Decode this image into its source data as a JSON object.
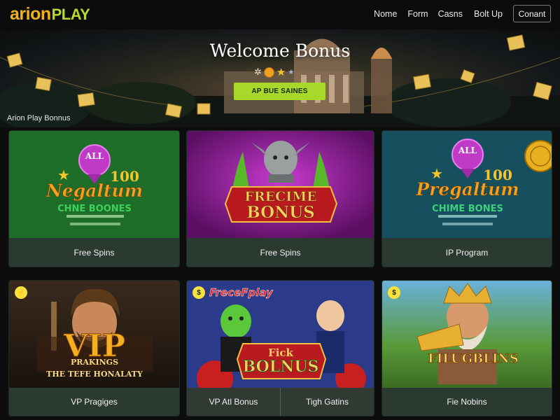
{
  "nav": {
    "logo_brand": "arion",
    "logo_play": "PLAY",
    "links": [
      "Nome",
      "Form",
      "Casns",
      "Bolt Up"
    ],
    "contact_label": "Conant"
  },
  "hero": {
    "title": "Welcome Bonus",
    "cta_label": "AP BUE SAINES",
    "section_label": "Arion Play Bonnus"
  },
  "cards": [
    {
      "caption": "Free Spins",
      "art_badge": "ALL",
      "art_number": "100",
      "art_title": "Negaltum",
      "art_subtitle": "CHNE BOONES"
    },
    {
      "caption": "Free Spins",
      "art_title_1": "FRECIME",
      "art_title_2": "BONUS"
    },
    {
      "caption": "IP Program",
      "art_badge": "ALL",
      "art_number": "100",
      "art_title": "Pregaltum",
      "art_subtitle": "CHIME BONES"
    },
    {
      "caption": "VP Pragiges",
      "art_title": "VIP",
      "art_subtitle_1": "PRAKINGS",
      "art_subtitle_2": "THE TEFE HONALATY"
    },
    {
      "caption_left": "VP Atl Bonus",
      "caption_right": "Tigh Gatins",
      "art_brand": "FreceFplay",
      "art_title_1": "Fick",
      "art_title_2": "BOLNUS"
    },
    {
      "caption": "Fie Nobins",
      "art_title": "FILUGBLINS"
    }
  ],
  "colors": {
    "accent_green": "#a8d82a",
    "brand_orange": "#f0b21a",
    "caption_bg": "#2b3a30",
    "badge_yellow": "#f7e13a"
  }
}
